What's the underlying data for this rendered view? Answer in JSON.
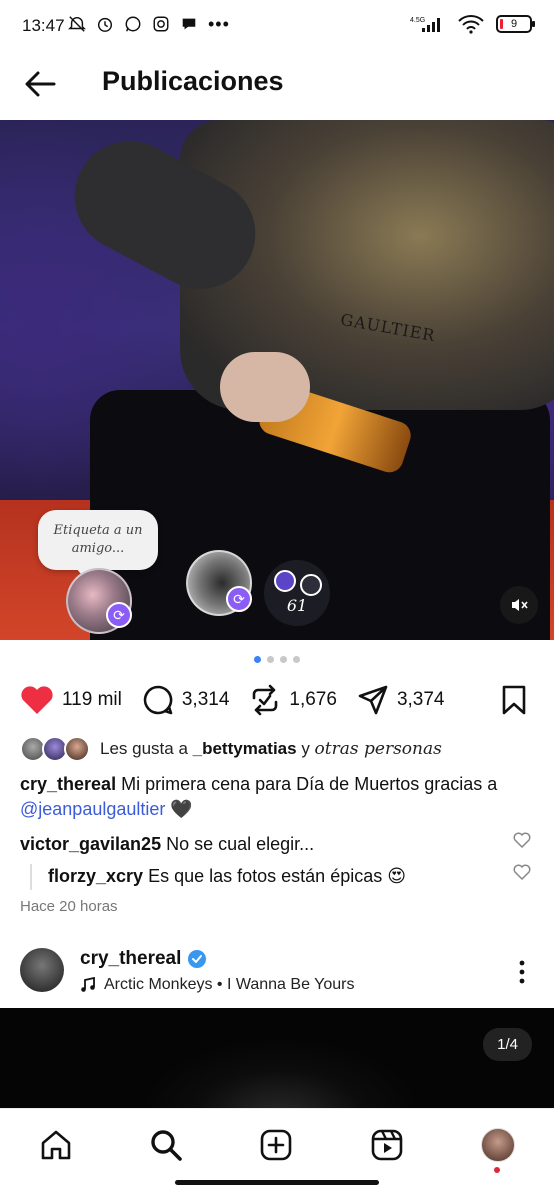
{
  "status_bar": {
    "time": "13:47",
    "icons": [
      "mute-icon",
      "alarm-icon",
      "whatsapp-icon",
      "instagram-icon",
      "chat-icon",
      "more-dots-icon",
      "signal-icon",
      "wifi-icon",
      "battery-icon"
    ],
    "more": "•••",
    "network": "4.5G",
    "battery": "9"
  },
  "header": {
    "title": "Publicaciones"
  },
  "post": {
    "shirt_text": "GAULTIER",
    "tag_prompt": "Etiqueta a un amigo...",
    "reposters_count": "61",
    "carousel_pages": 4,
    "carousel_active": 1,
    "likes": "119 mil",
    "comments": "3,314",
    "reposts": "1,676",
    "shares": "3,374",
    "liked_by_prefix": "Les gusta a",
    "liked_by_user": "_bettymatias",
    "liked_by_joiner": "y",
    "liked_by_suffix": "otras personas",
    "caption_user": "cry_thereal",
    "caption_text": "Mi primera cena para Día de Muertos gracias a",
    "caption_mention": "@jeanpaulgaultier",
    "caption_emoji": "🖤",
    "comments_list": [
      {
        "user": "victor_gavilan25",
        "text": "No se cual elegir..."
      },
      {
        "user": "florzy_xcry",
        "text": "Es que las fotos están épicas 😍"
      }
    ],
    "time_ago": "Hace 20 horas"
  },
  "next_post": {
    "user": "cry_thereal",
    "music": "Arctic Monkeys • I Wanna Be Yours",
    "pager": "1/4"
  },
  "colors": {
    "like_red": "#ed2e43",
    "mention_blue": "#3b5bdb",
    "repost_purple": "#8b5cf6",
    "active_dot": "#3b82f6"
  }
}
